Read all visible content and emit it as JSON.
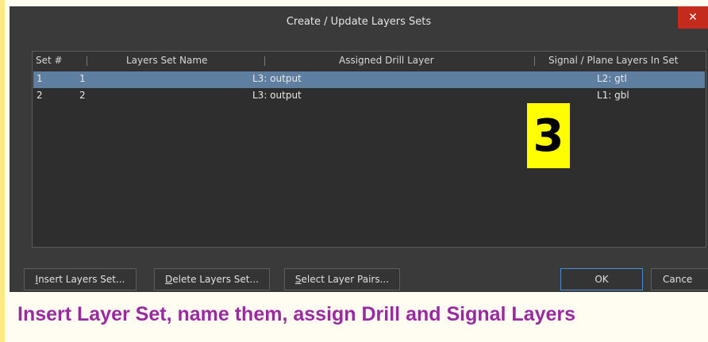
{
  "window": {
    "title": "Create / Update Layers Sets",
    "close_glyph": "✕"
  },
  "table": {
    "headers": [
      "Set #",
      "Layers Set Name",
      "Assigned Drill Layer",
      "Signal / Plane Layers In Set"
    ],
    "rows": [
      {
        "set": "1",
        "name": "1",
        "drill": "L3: output",
        "signal": "L2: gtl",
        "selected": true
      },
      {
        "set": "2",
        "name": "2",
        "drill": "L3: output",
        "signal": "L1: gbl",
        "selected": false
      }
    ]
  },
  "overlay_badge": "3",
  "buttons": {
    "insert_prefix": "I",
    "insert_rest": "nsert Layers Set...",
    "delete_prefix": "D",
    "delete_rest": "elete Layers Set...",
    "select_prefix": "S",
    "select_rest": "elect Layer Pairs...",
    "ok": "OK",
    "cancel": "Cance"
  },
  "caption": "Insert Layer Set, name them, assign Drill and Signal Layers",
  "colors": {
    "caption": "#9a2aa0",
    "selection": "#5f7fa1",
    "badge": "#ffff00",
    "close_button": "#c42b1c"
  }
}
